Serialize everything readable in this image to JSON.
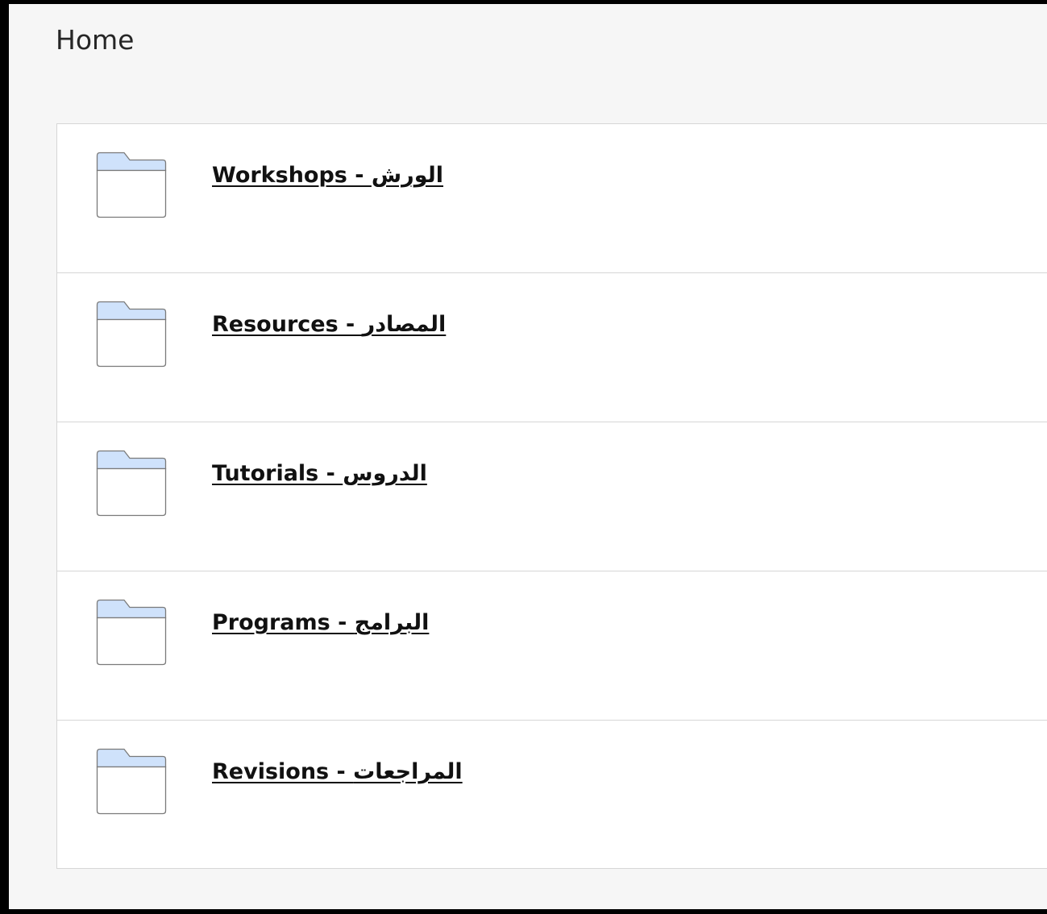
{
  "page": {
    "title": "Home"
  },
  "colors": {
    "background": "#f6f6f6",
    "panel": "#ffffff",
    "border": "#d6d6d6",
    "folder_tab": "#cfe2fb",
    "folder_outline": "#7a7a7a",
    "link_text": "#111111"
  },
  "folders": [
    {
      "label": "Workshops - الورش",
      "icon": "folder-icon"
    },
    {
      "label": "Resources - المصادر",
      "icon": "folder-icon"
    },
    {
      "label": "Tutorials - الدروس",
      "icon": "folder-icon"
    },
    {
      "label": "Programs - البرامج",
      "icon": "folder-icon"
    },
    {
      "label": "Revisions - المراجعات",
      "icon": "folder-icon"
    }
  ]
}
